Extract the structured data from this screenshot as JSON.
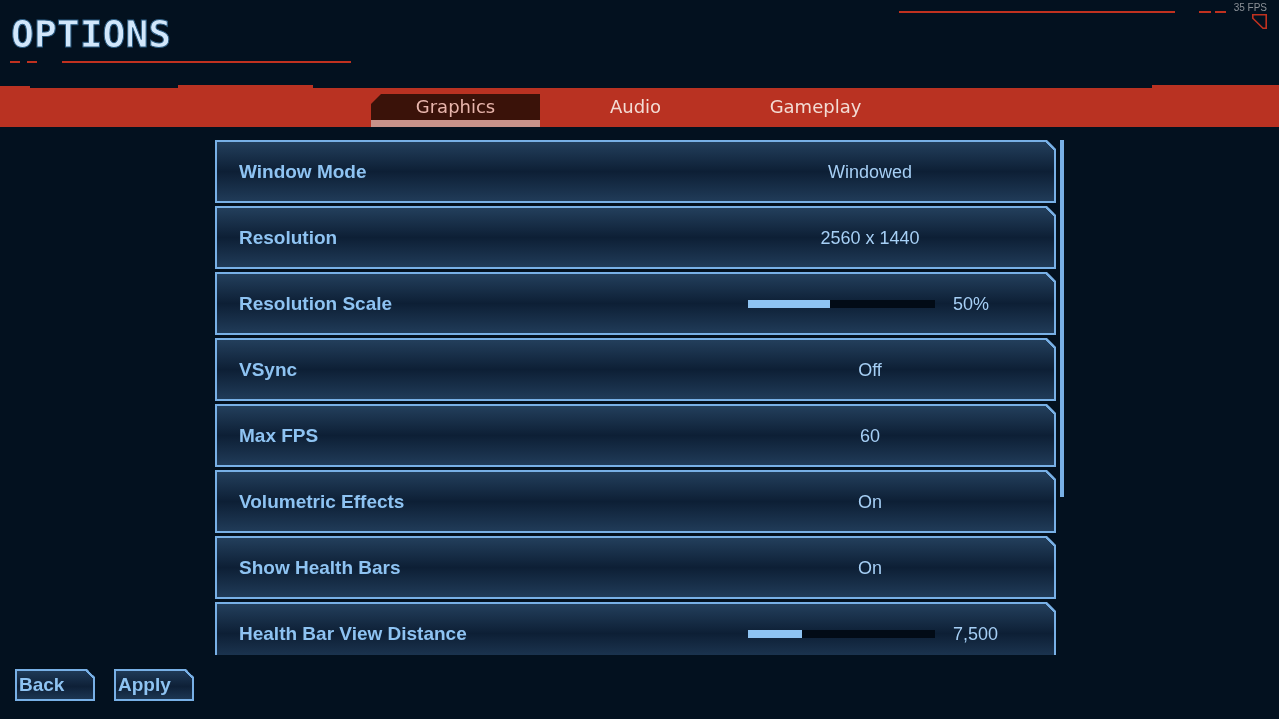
{
  "header": {
    "title": "OPTIONS",
    "fps": "35 FPS"
  },
  "tabs": [
    {
      "label": "Graphics",
      "selected": true
    },
    {
      "label": "Audio",
      "selected": false
    },
    {
      "label": "Gameplay",
      "selected": false
    }
  ],
  "settings": [
    {
      "kind": "choice",
      "label": "Window Mode",
      "value": "Windowed"
    },
    {
      "kind": "choice",
      "label": "Resolution",
      "value": "2560 x 1440"
    },
    {
      "kind": "slider",
      "label": "Resolution Scale",
      "level": 0.44,
      "reading": "50%"
    },
    {
      "kind": "choice",
      "label": "VSync",
      "value": "Off"
    },
    {
      "kind": "choice",
      "label": "Max FPS",
      "value": "60"
    },
    {
      "kind": "choice",
      "label": "Volumetric Effects",
      "value": "On"
    },
    {
      "kind": "choice",
      "label": "Show Health Bars",
      "value": "On"
    },
    {
      "kind": "slider",
      "label": "Health Bar View Distance",
      "level": 0.29,
      "reading": "7,500"
    }
  ],
  "buttons": [
    "Back",
    "Apply"
  ]
}
